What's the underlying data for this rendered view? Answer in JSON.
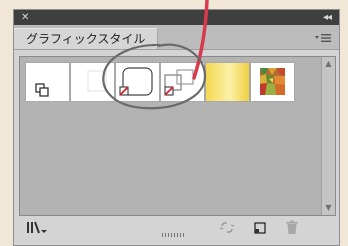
{
  "titlebar": {
    "close_icon": "close-icon",
    "collapse_icon": "collapse-icon"
  },
  "tab": {
    "label": "グラフィックスタイル"
  },
  "panel_menu_icon": "panel-menu-icon",
  "swatches": [
    {
      "name": "default-style",
      "kind": "default"
    },
    {
      "name": "blank-style",
      "kind": "blank"
    },
    {
      "name": "rounded-rect-style",
      "kind": "rounded-none"
    },
    {
      "name": "offset-rect-style",
      "kind": "offset-none"
    },
    {
      "name": "yellow-gradient-style",
      "kind": "gradient"
    },
    {
      "name": "mosaic-style",
      "kind": "mosaic"
    }
  ],
  "bottom_icons": [
    "library-menu-icon",
    "break-link-icon",
    "new-style-icon",
    "trash-icon"
  ],
  "colors": {
    "annotation_red": "#d83a4d",
    "circle_gray": "#6a6a6a"
  }
}
